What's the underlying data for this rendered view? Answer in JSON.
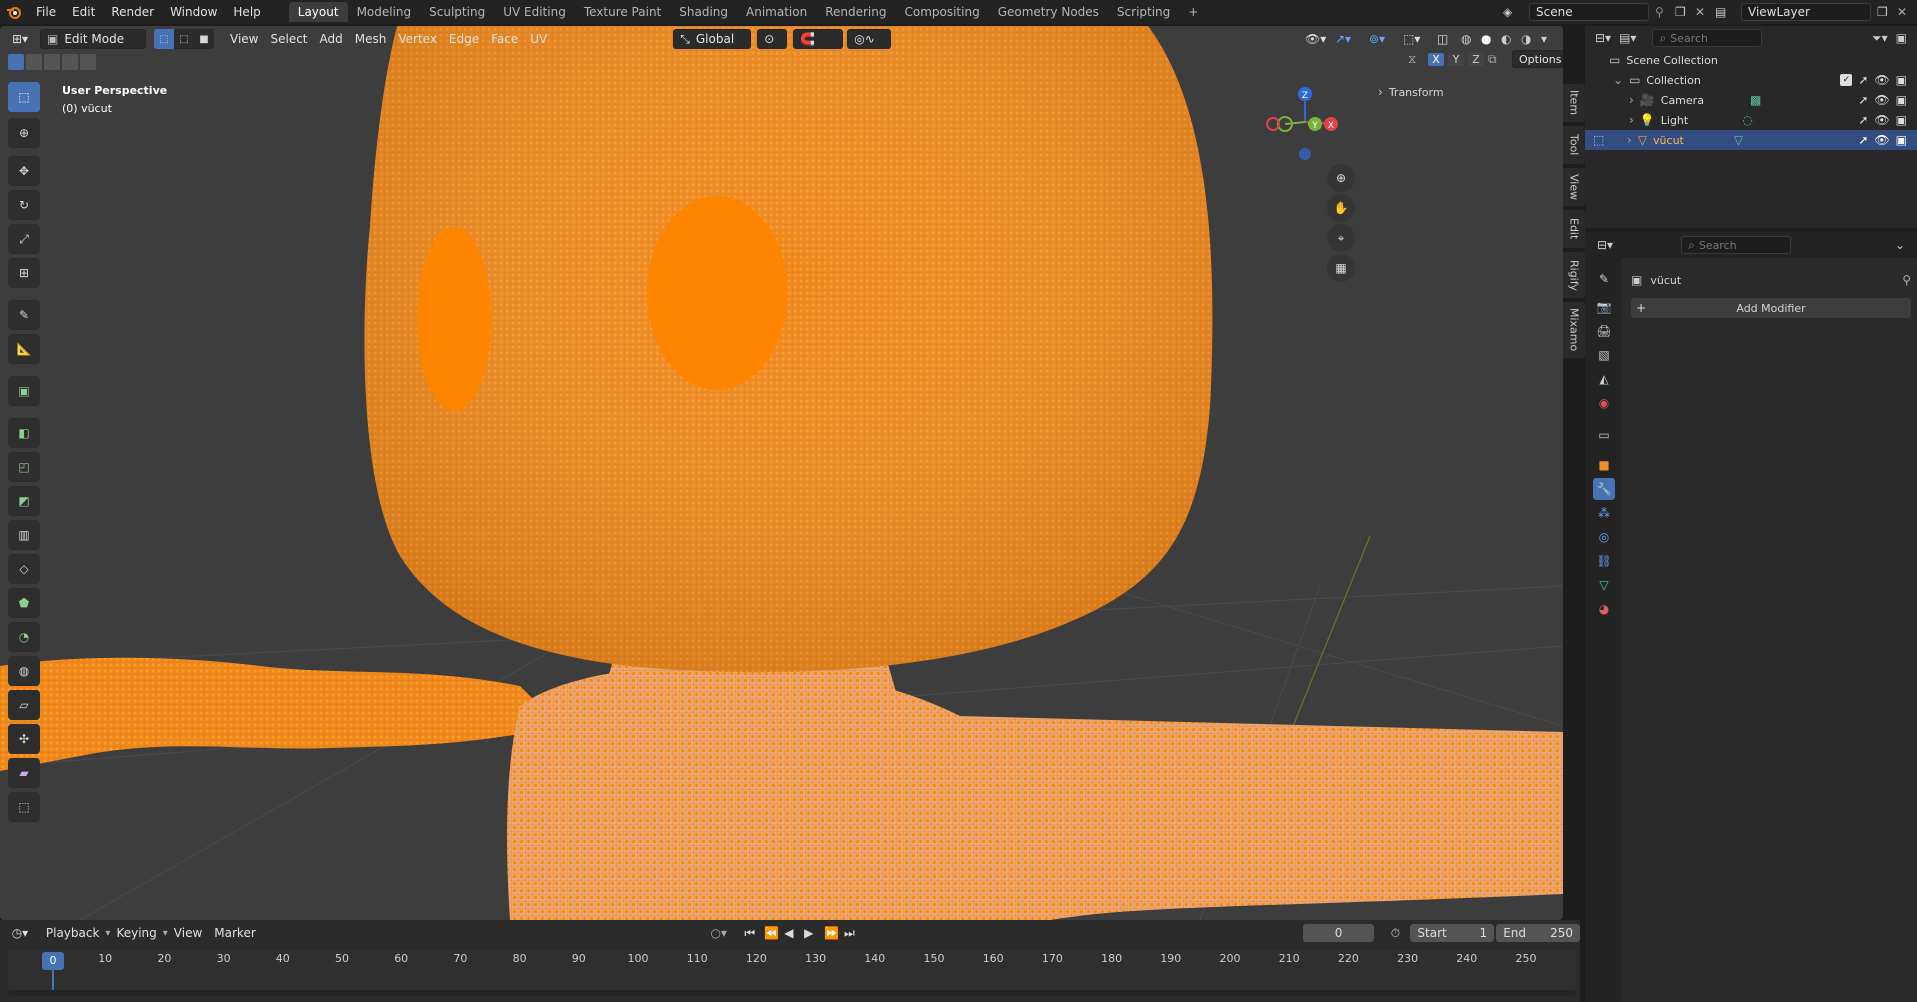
{
  "app": {
    "menus": [
      "File",
      "Edit",
      "Render",
      "Window",
      "Help"
    ],
    "workspaces": [
      "Layout",
      "Modeling",
      "Sculpting",
      "UV Editing",
      "Texture Paint",
      "Shading",
      "Animation",
      "Rendering",
      "Compositing",
      "Geometry Nodes",
      "Scripting"
    ],
    "active_workspace": "Layout",
    "scene": "Scene",
    "view_layer": "ViewLayer"
  },
  "viewport": {
    "mode": "Edit Mode",
    "menus": [
      "View",
      "Select",
      "Add",
      "Mesh",
      "Vertex",
      "Edge",
      "Face",
      "UV"
    ],
    "orientation": "Global",
    "overlay_title": "User Perspective",
    "overlay_object": "(0) vücut",
    "sidebar_section": "Transform",
    "options_label": "Options",
    "axes": {
      "x": "X",
      "y": "Y",
      "z": "Z"
    },
    "side_tabs": [
      "Item",
      "Tool",
      "View",
      "Edit",
      "Rigify",
      "Mixamo"
    ],
    "accent": "#ff8a00",
    "bg": "#3d3d3d"
  },
  "outliner": {
    "search_placeholder": "Search",
    "root": "Scene Collection",
    "collection": "Collection",
    "items": [
      {
        "name": "Camera",
        "icon": "camera-icon"
      },
      {
        "name": "Light",
        "icon": "light-icon"
      },
      {
        "name": "vücut",
        "icon": "mesh-icon",
        "selected": true
      }
    ]
  },
  "properties": {
    "search_placeholder": "Search",
    "object_name": "vücut",
    "add_modifier": "Add Modifier"
  },
  "timeline": {
    "menus": [
      "Playback",
      "Keying",
      "View",
      "Marker"
    ],
    "current_frame": "0",
    "start_label": "Start",
    "start_value": "1",
    "end_label": "End",
    "end_value": "250",
    "ticks": [
      "0",
      "10",
      "20",
      "30",
      "40",
      "50",
      "60",
      "70",
      "80",
      "90",
      "100",
      "110",
      "120",
      "130",
      "140",
      "150",
      "160",
      "170",
      "180",
      "190",
      "200",
      "210",
      "220",
      "230",
      "240",
      "250"
    ]
  }
}
